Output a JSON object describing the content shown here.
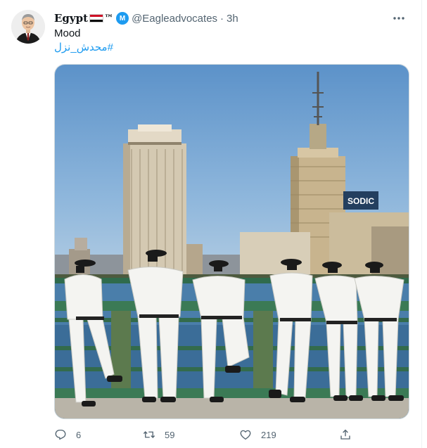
{
  "tweet": {
    "author_name": "Egypt",
    "author_tm": "™",
    "verified_badge": "M",
    "handle": "@Eagleadvocates",
    "separator": "·",
    "time": "3h",
    "text": "Mood",
    "hashtag": "#محدش_نزل",
    "more_icon": "more-horizontal-icon"
  },
  "media": {
    "sign_text": "SODIC"
  },
  "actions": {
    "replies": "6",
    "retweets": "59",
    "likes": "219"
  },
  "colors": {
    "accent": "#1d9bf0",
    "muted": "#536471",
    "text": "#0f1419"
  }
}
